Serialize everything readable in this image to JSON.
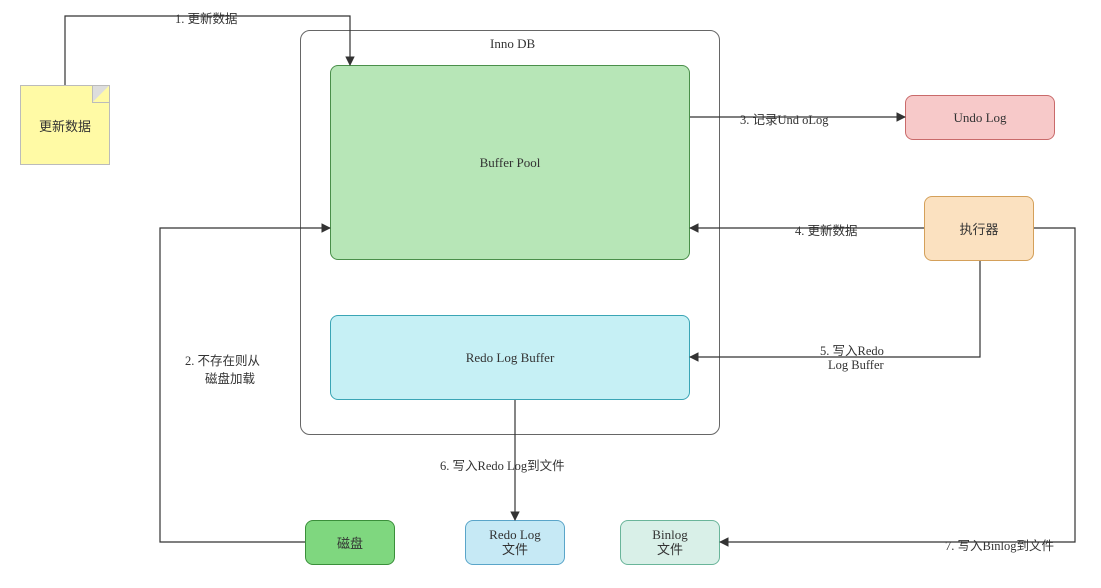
{
  "container": {
    "label": "Inno DB"
  },
  "nodes": {
    "update_note": "更新数据",
    "buffer_pool": "Buffer Pool",
    "redo_log_buffer": "Redo Log Buffer",
    "undo_log": "Undo Log",
    "executor": "执行器",
    "disk": "磁盘",
    "redo_log_file": "Redo Log",
    "redo_log_file_sub": "文件",
    "binlog_file": "Binlog",
    "binlog_file_sub": "文件"
  },
  "edges": {
    "e1": "1. 更新数据",
    "e2a": "2. 不存在则从",
    "e2b": "磁盘加载",
    "e3": "3. 记录Und oLog",
    "e4": "4. 更新数据",
    "e5a": "5. 写入Redo",
    "e5b": "Log Buffer",
    "e6": "6. 写入Redo Log到文件",
    "e7": "7. 写入Binlog到文件"
  },
  "colors": {
    "buffer_pool_fill": "#b7e6b7",
    "buffer_pool_stroke": "#4a8f4a",
    "redo_buffer_fill": "#c6f0f5",
    "redo_buffer_stroke": "#3aa5b5",
    "undo_fill": "#f7c9c9",
    "undo_stroke": "#c96a6a",
    "executor_fill": "#fbe1c0",
    "executor_stroke": "#d4a05a",
    "disk_fill": "#7fd77f",
    "disk_stroke": "#3a8f3a",
    "redo_file_fill": "#c6e9f5",
    "redo_file_stroke": "#5aa5c9",
    "binlog_fill": "#d9f0e8",
    "binlog_stroke": "#6ab59a"
  }
}
